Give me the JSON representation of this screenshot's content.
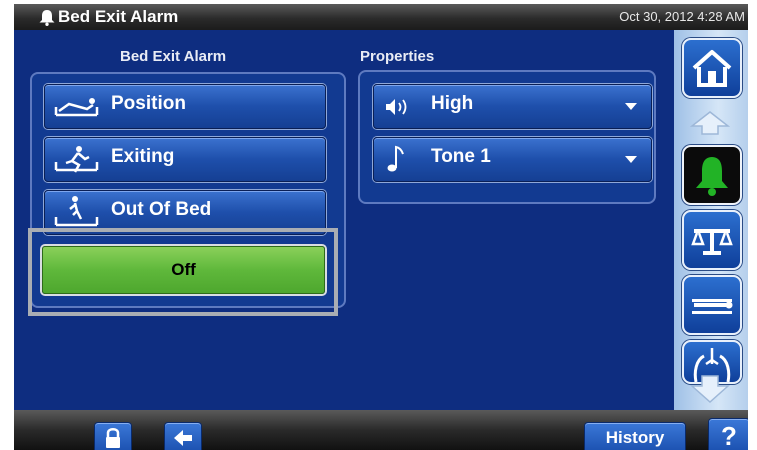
{
  "titlebar": {
    "title": "Bed Exit Alarm",
    "datetime": "Oct 30, 2012 4:28 AM"
  },
  "left_panel": {
    "label": "Bed Exit Alarm",
    "options": [
      {
        "label": "Position",
        "icon": "bed-position-icon"
      },
      {
        "label": "Exiting",
        "icon": "patient-exiting-icon"
      },
      {
        "label": "Out Of Bed",
        "icon": "out-of-bed-icon"
      }
    ],
    "off_label": "Off"
  },
  "properties": {
    "label": "Properties",
    "volume": {
      "value": "High",
      "icon": "speaker-icon"
    },
    "tone": {
      "value": "Tone 1",
      "icon": "music-note-icon"
    }
  },
  "rail": {
    "items": [
      "home-icon",
      "bell-icon",
      "scale-icon",
      "bed-icon",
      "lungs-icon"
    ],
    "active": "bell-icon",
    "colors": {
      "active_bell": "#22b326"
    }
  },
  "bottombar": {
    "history_label": "History",
    "help_label": "?"
  },
  "colors": {
    "background": "#0e2d80",
    "off_button": "#5fb83b",
    "button": "#1e4fab"
  }
}
